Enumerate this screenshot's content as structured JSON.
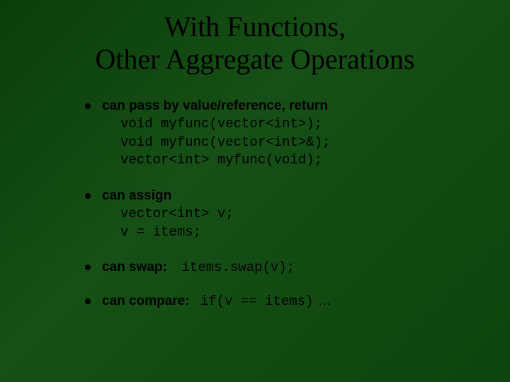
{
  "title_line1": "With Functions,",
  "title_line2": "Other Aggregate Operations",
  "bullets": {
    "b1": {
      "lead": "can pass by value/reference, return",
      "code": "void myfunc(vector<int>);\nvoid myfunc(vector<int>&);\nvector<int> myfunc(void);"
    },
    "b2": {
      "lead": "can assign",
      "code": "vector<int> v;\nv = items;"
    },
    "b3": {
      "lead": "can swap:",
      "code": "items.swap(v);"
    },
    "b4": {
      "lead": "can compare:",
      "code": "if(v == items)",
      "trail": "…"
    }
  }
}
